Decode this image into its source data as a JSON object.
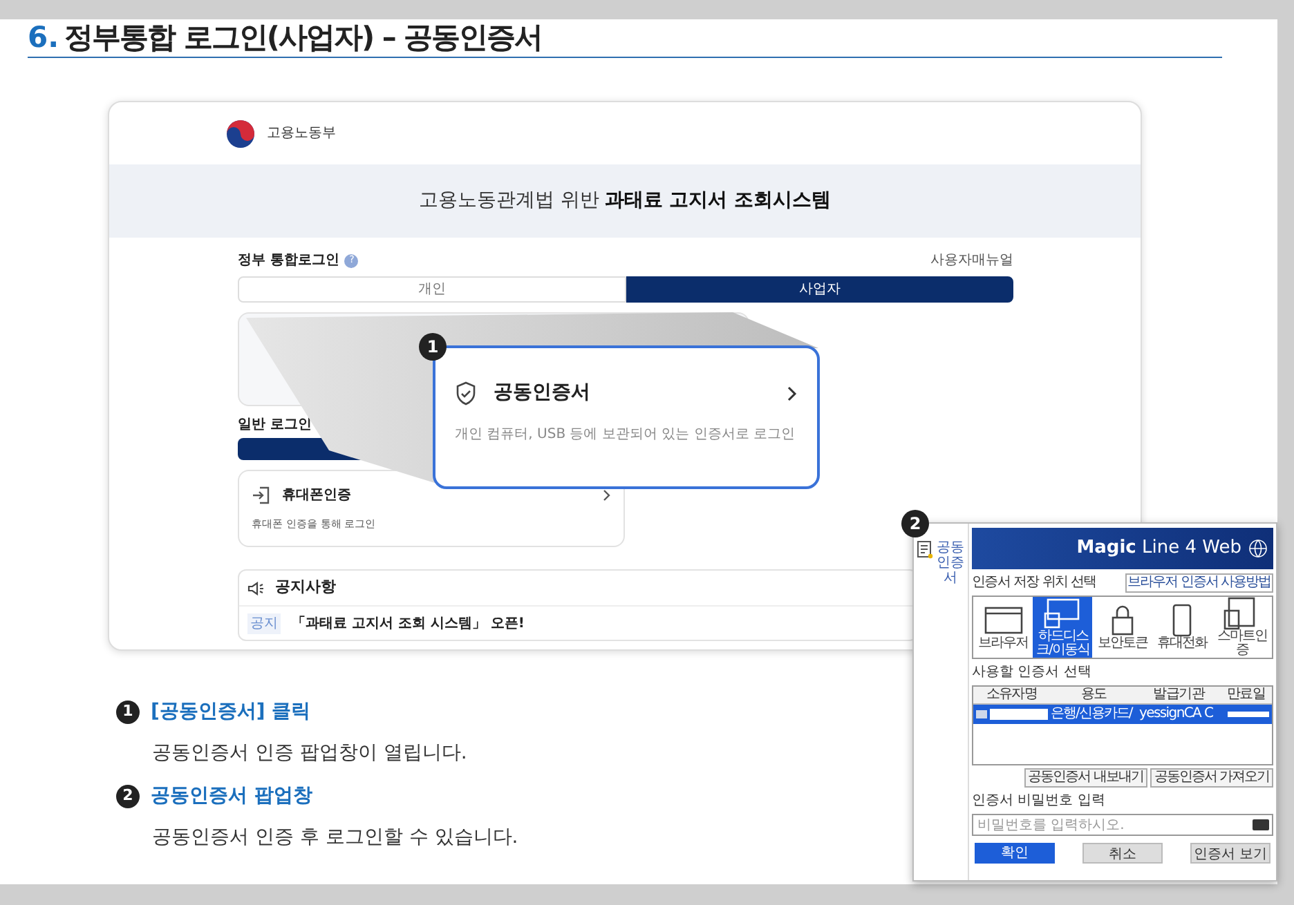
{
  "heading": {
    "number": "6.",
    "title": "정부통합 로그인(사업자) – 공동인증서"
  },
  "site": {
    "logo_text": "고용노동부",
    "banner_prefix": "고용노동관계법 위반",
    "banner_bold": "과태료 고지서 조회시스템",
    "integrated_label": "정부 통합로그인",
    "help": "?",
    "manual": "사용자매뉴얼",
    "tabs": [
      {
        "label": "개인",
        "selected": false
      },
      {
        "label": "사업자",
        "selected": true
      }
    ],
    "general_label": "일반 로그인",
    "phone_card": {
      "title": "휴대폰인증",
      "desc": "휴대폰 인증을 통해 로그인"
    },
    "notice": {
      "title": "공지사항",
      "items": [
        {
          "tag": "공지",
          "text": "「과태료 고지서 조회 시스템」 오픈!"
        }
      ]
    }
  },
  "callout": {
    "badge": "1",
    "title": "공동인증서",
    "desc": "개인 컴퓨터, USB 등에 보관되어 있는 인증서로 로그인"
  },
  "popup": {
    "badge": "2",
    "side_label": "공동 인증서",
    "brand_bold": "Magic",
    "brand_rest": "Line 4 Web",
    "location_label": "인증서 저장 위치 선택",
    "help_button": "브라우저 인증서 사용방법",
    "locations": [
      {
        "kind": "browser",
        "label": "브라우저",
        "selected": false
      },
      {
        "kind": "disk",
        "label": "하드디스크/이동식",
        "selected": true
      },
      {
        "kind": "token",
        "label": "보안토큰",
        "selected": false
      },
      {
        "kind": "phone",
        "label": "휴대전화",
        "selected": false
      },
      {
        "kind": "smart",
        "label": "스마트인증",
        "selected": false
      }
    ],
    "cert_label": "사용할 인증서 선택",
    "columns": [
      "소유자명",
      "용도",
      "발급기관",
      "만료일"
    ],
    "rows": [
      {
        "purpose": "은행/신용카드/",
        "issuer": "yessignCA C",
        "selected": true
      }
    ],
    "tools": [
      "공동인증서 내보내기",
      "공동인증서 가져오기"
    ],
    "password_label": "인증서 비밀번호 입력",
    "password_placeholder": "비밀번호를 입력하시오.",
    "actions": [
      {
        "label": "확인",
        "kind": "primary"
      },
      {
        "label": "취소",
        "kind": "secondary"
      },
      {
        "label": "인증서 보기",
        "kind": "secondary"
      }
    ]
  },
  "steps": [
    {
      "number": "1",
      "title": "[공동인증서] 클릭",
      "desc": "공동인증서 인증 팝업창이 열립니다."
    },
    {
      "number": "2",
      "title": "공동인증서 팝업창",
      "desc": "공동인증서 인증 후 로그인할 수 있습니다."
    }
  ]
}
